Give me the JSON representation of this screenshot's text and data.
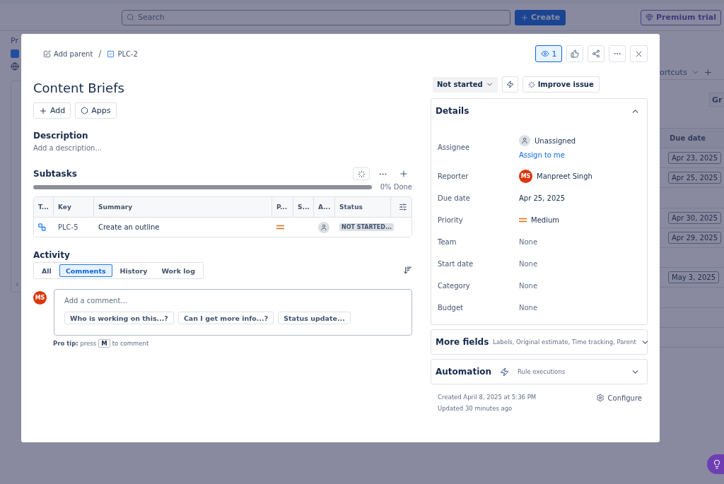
{
  "top_bar": {
    "search": {
      "placeholder": "Search"
    },
    "create_button": "Create",
    "premium_button": "Premium trial"
  },
  "background": {
    "left_heading": "Pr",
    "right_link": "ortcuts",
    "right_button": "Gr",
    "due_column": "Due date",
    "due_rows": [
      {
        "empty": false,
        "date": "Apr 23, 2025"
      },
      {
        "empty": false,
        "date": "Apr 25, 2025"
      },
      {
        "empty": true
      },
      {
        "empty": false,
        "date": "Apr 30, 2025"
      },
      {
        "empty": false,
        "date": "Apr 29, 2025"
      },
      {
        "empty": true
      },
      {
        "empty": false,
        "date": "May 3, 2025"
      },
      {
        "empty": true
      },
      {
        "empty": true
      },
      {
        "empty": true
      }
    ]
  },
  "dialog": {
    "breadcrumb": {
      "add_parent": "Add parent",
      "separator": "/",
      "issue_key": "PLC-2"
    },
    "header_actions": {
      "watchers": "1",
      "watching": true
    },
    "title": "Content Briefs",
    "actions": [
      "Add",
      "Apps"
    ],
    "description": {
      "heading": "Description",
      "placeholder": "Add a description..."
    },
    "subtasks": {
      "heading": "Subtasks",
      "progress": {
        "level": 0,
        "reading": "0% Done"
      },
      "columns": [
        "T...",
        "Key",
        "Summary",
        "P...",
        "S...",
        "A...",
        "Status"
      ],
      "rows": [
        {
          "key": "PLC-5",
          "summary": "Create an outline",
          "assigned": false,
          "status": "NOT STARTED..."
        }
      ]
    },
    "activity": {
      "heading": "Activity",
      "tabs": [
        {
          "label": "All",
          "selected": false
        },
        {
          "label": "Comments",
          "selected": true
        },
        {
          "label": "History",
          "selected": false
        },
        {
          "label": "Work log",
          "selected": false
        }
      ],
      "avatar": "MS",
      "comment": {
        "placeholder": "Add a comment…"
      },
      "suggestions": [
        "Who is working on this...?",
        "Can I get more info...?",
        "Status update..."
      ],
      "pro_tip": {
        "before": "**Pro tip:** press",
        "key": "M",
        "after": "to comment"
      }
    },
    "status": {
      "label": "Not started"
    },
    "improve_button": "Improve issue",
    "details": {
      "heading": "Details",
      "expanded": true,
      "fields": [
        {
          "label": "Assignee",
          "kind": "assignee",
          "value": "Unassigned",
          "link": "Assign to me"
        },
        {
          "label": "Reporter",
          "kind": "user",
          "value": "Manpreet Singh",
          "avatar": "MS"
        },
        {
          "label": "Due date",
          "kind": "text",
          "value": "Apr 25, 2025"
        },
        {
          "label": "Priority",
          "kind": "priority",
          "value": "Medium"
        },
        {
          "label": "Team",
          "kind": "empty",
          "value": "None"
        },
        {
          "label": "Start date",
          "kind": "empty",
          "value": "None"
        },
        {
          "label": "Category",
          "kind": "empty",
          "value": "None"
        },
        {
          "label": "Budget",
          "kind": "empty",
          "value": "None"
        }
      ]
    },
    "more_fields": {
      "heading": "More fields",
      "summary": "Labels, Original estimate, Time tracking, Parent",
      "expanded": false
    },
    "automation": {
      "heading": "Automation",
      "summary": "Rule executions",
      "expanded": false
    },
    "footer": {
      "created": "Created April 8, 2025 at 5:36 PM",
      "updated": "Updated 30 minutes ago",
      "configure": "Configure"
    }
  }
}
